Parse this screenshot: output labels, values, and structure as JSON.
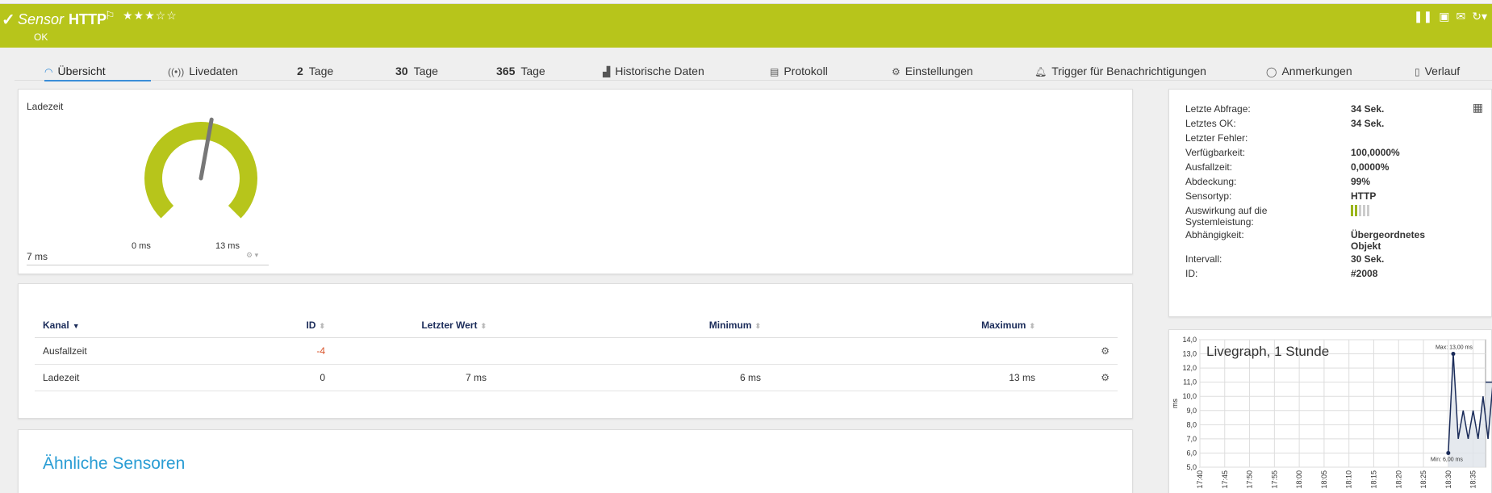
{
  "header": {
    "title_prefix": "Sensor",
    "title_name": "HTTP",
    "status": "OK",
    "bg_color": "#b7c51b",
    "rating_stars_filled": 3,
    "rating_stars_total": 5
  },
  "tabs": [
    {
      "label": "Übersicht",
      "icon": "gauge-icon"
    },
    {
      "label": "Livedaten",
      "icon": "broadcast-icon"
    },
    {
      "num": "2",
      "label": "Tage"
    },
    {
      "num": "30",
      "label": "Tage"
    },
    {
      "num": "365",
      "label": "Tage"
    },
    {
      "label": "Historische Daten",
      "icon": "area-chart-icon"
    },
    {
      "label": "Protokoll",
      "icon": "log-icon"
    },
    {
      "label": "Einstellungen",
      "icon": "gear-icon"
    },
    {
      "label": "Trigger für Benachrichtigungen",
      "icon": "bell-icon"
    },
    {
      "label": "Anmerkungen",
      "icon": "comment-icon"
    },
    {
      "label": "Verlauf",
      "icon": "history-icon"
    }
  ],
  "gauge": {
    "title": "Ladezeit",
    "current": "7 ms",
    "min_label": "0 ms",
    "max_label": "13 ms",
    "value_fraction": 0.538
  },
  "channels": {
    "headers": [
      "Kanal",
      "ID",
      "Letzter Wert",
      "Minimum",
      "Maximum"
    ],
    "rows": [
      {
        "kanal": "Ausfallzeit",
        "id": "-4",
        "last": "",
        "min": "",
        "max": ""
      },
      {
        "kanal": "Ladezeit",
        "id": "0",
        "last": "7 ms",
        "min": "6 ms",
        "max": "13 ms"
      }
    ]
  },
  "similar": {
    "heading": "Ähnliche Sensoren"
  },
  "info": [
    {
      "label": "Letzte Abfrage:",
      "value": "34 Sek."
    },
    {
      "label": "Letztes OK:",
      "value": "34 Sek."
    },
    {
      "label": "Letzter Fehler:",
      "value": ""
    },
    {
      "label": "Verfügbarkeit:",
      "value": "100,0000%"
    },
    {
      "label": "Ausfallzeit:",
      "value": "0,0000%"
    },
    {
      "label": "Abdeckung:",
      "value": "99%"
    },
    {
      "label": "Sensortyp:",
      "value": "HTTP"
    },
    {
      "label": "Auswirkung auf die",
      "label2": "Systemleistung:",
      "value": "",
      "perf_level": 2,
      "perf_total": 5
    },
    {
      "label": "Abhängigkeit:",
      "value": "Übergeordnetes",
      "value2": "Objekt"
    },
    {
      "label": "Intervall:",
      "value": "30 Sek."
    },
    {
      "label": "ID:",
      "value": "#2008"
    }
  ],
  "chart_data": {
    "type": "line",
    "title": "Livegraph, 1 Stunde",
    "ylabel": "ms",
    "ylim": [
      5.0,
      14.0
    ],
    "yticks": [
      "5,0",
      "6,0",
      "7,0",
      "8,0",
      "9,0",
      "10,0",
      "11,0",
      "12,0",
      "13,0",
      "14,0"
    ],
    "xticks": [
      "17:40",
      "17:45",
      "17:50",
      "17:55",
      "18:00",
      "18:05",
      "18:10",
      "18:15",
      "18:20",
      "18:25",
      "18:30",
      "18:35"
    ],
    "series": [
      {
        "name": "Ladezeit",
        "color": "#1b2c5a",
        "x": [
          "18:30",
          "18:31",
          "18:32",
          "18:33",
          "18:34",
          "18:35",
          "18:36",
          "18:37",
          "18:38",
          "18:39"
        ],
        "values": [
          6.0,
          13.0,
          7.0,
          9.0,
          7.0,
          9.0,
          7.0,
          10.0,
          7.0,
          11.0
        ]
      }
    ],
    "annotations": [
      {
        "text": "Max: 13,00 ms",
        "x": "18:31",
        "y": 13.0
      },
      {
        "text": "Min: 6,00 ms",
        "x": "18:30",
        "y": 6.0
      }
    ]
  }
}
